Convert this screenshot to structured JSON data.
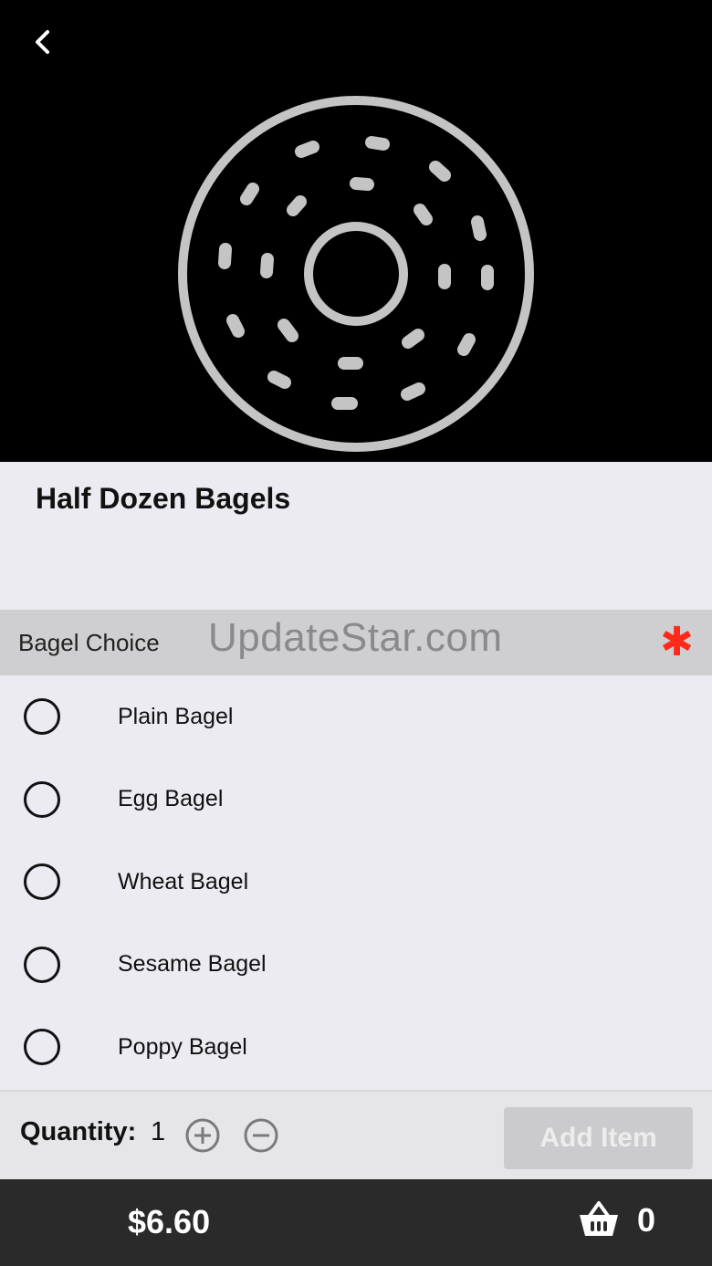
{
  "header": {
    "back_icon": "chevron-left-icon",
    "hero_icon": "donut-bagel-icon"
  },
  "item": {
    "title": "Half Dozen Bagels"
  },
  "section": {
    "label": "Bagel Choice",
    "watermark": "UpdateStar.com",
    "required_marker": "✱",
    "required_color": "#ff2a1a"
  },
  "options": [
    {
      "label": "Plain Bagel",
      "selected": false
    },
    {
      "label": "Egg Bagel",
      "selected": false
    },
    {
      "label": "Wheat Bagel",
      "selected": false
    },
    {
      "label": "Sesame Bagel",
      "selected": false
    },
    {
      "label": "Poppy Bagel",
      "selected": false
    }
  ],
  "quantity": {
    "label": "Quantity:",
    "value": "1",
    "add_label": "Add Item"
  },
  "footer": {
    "total": "$6.60",
    "cart_count": "0",
    "cart_icon": "basket-icon"
  }
}
